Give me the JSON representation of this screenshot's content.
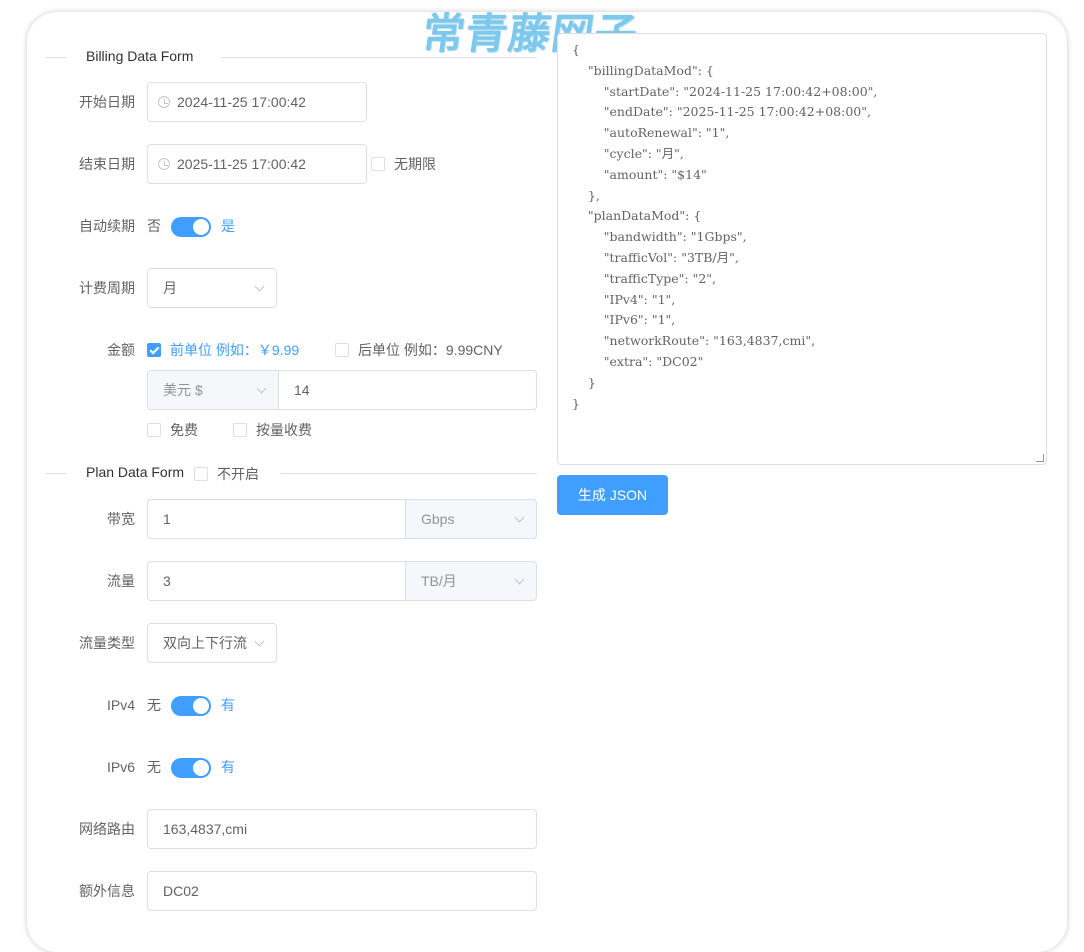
{
  "watermark": "常青藤网子",
  "billing": {
    "section_title": "Billing Data Form",
    "start_label": "开始日期",
    "start_value": "2024-11-25 17:00:42",
    "end_label": "结束日期",
    "end_value": "2025-11-25 17:00:42",
    "no_limit_label": "无期限",
    "no_limit_checked": false,
    "renew_label": "自动续期",
    "renew_off": "否",
    "renew_on": "是",
    "renew_enabled": true,
    "cycle_label": "计费周期",
    "cycle_value": "月",
    "amount_label": "金额",
    "prefix_unit_label": "前单位 例如：￥9.99",
    "prefix_unit_checked": true,
    "suffix_unit_label": "后单位 例如：9.99CNY",
    "suffix_unit_checked": false,
    "currency_value": "美元 $",
    "amount_value": "14",
    "free_label": "免费",
    "free_checked": false,
    "usage_label": "按量收费",
    "usage_checked": false
  },
  "plan": {
    "section_title": "Plan Data Form",
    "disable_label": "不开启",
    "disable_checked": false,
    "bandwidth_label": "带宽",
    "bandwidth_value": "1",
    "bandwidth_unit": "Gbps",
    "traffic_label": "流量",
    "traffic_value": "3",
    "traffic_unit": "TB/月",
    "traffic_type_label": "流量类型",
    "traffic_type_value": "双向上下行流",
    "ipv4_label": "IPv4",
    "ipv4_off": "无",
    "ipv4_on": "有",
    "ipv4_enabled": true,
    "ipv6_label": "IPv6",
    "ipv6_off": "无",
    "ipv6_on": "有",
    "ipv6_enabled": true,
    "route_label": "网络路由",
    "route_value": "163,4837,cmi",
    "extra_label": "额外信息",
    "extra_value": "DC02"
  },
  "output": {
    "json_text": "{\n    \"billingDataMod\": {\n        \"startDate\": \"2024-11-25 17:00:42+08:00\",\n        \"endDate\": \"2025-11-25 17:00:42+08:00\",\n        \"autoRenewal\": \"1\",\n        \"cycle\": \"月\",\n        \"amount\": \"$14\"\n    },\n    \"planDataMod\": {\n        \"bandwidth\": \"1Gbps\",\n        \"trafficVol\": \"3TB/月\",\n        \"trafficType\": \"2\",\n        \"IPv4\": \"1\",\n        \"IPv6\": \"1\",\n        \"networkRoute\": \"163,4837,cmi\",\n        \"extra\": \"DC02\"\n    }\n}",
    "generate_button": "生成 JSON"
  },
  "colors": {
    "accent": "#409eff",
    "border": "#dcdfe6",
    "text": "#606266"
  }
}
